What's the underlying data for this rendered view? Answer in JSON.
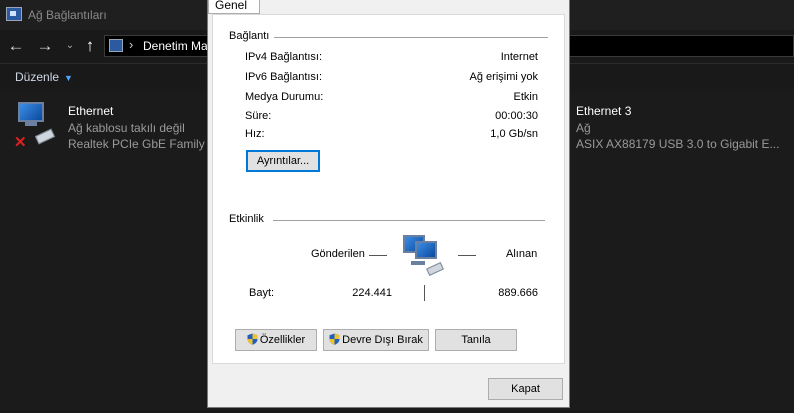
{
  "explorer": {
    "title": "Ağ Bağlantıları",
    "breadcrumb": "Denetim Ma",
    "organize_label": "Düzenle",
    "adapters": [
      {
        "name": "Ethernet",
        "status": "Ağ kablosu takılı değil",
        "device": "Realtek PCIe GbE Family Co",
        "disconnected": true
      },
      {
        "name": "Ethernet 3",
        "status": "Ağ",
        "device": "ASIX AX88179 USB 3.0 to Gigabit E...",
        "disconnected": false
      }
    ]
  },
  "dialog": {
    "tab_label": "Genel",
    "connection": {
      "group_label": "Bağlantı",
      "rows": [
        {
          "label": "IPv4 Bağlantısı:",
          "value": "Internet"
        },
        {
          "label": "IPv6 Bağlantısı:",
          "value": "Ağ erişimi yok"
        },
        {
          "label": "Medya Durumu:",
          "value": "Etkin"
        },
        {
          "label": "Süre:",
          "value": "00:00:30"
        },
        {
          "label": "Hız:",
          "value": "1,0 Gb/sn"
        }
      ],
      "details_button": "Ayrıntılar..."
    },
    "activity": {
      "group_label": "Etkinlik",
      "sent_label": "Gönderilen",
      "received_label": "Alınan",
      "bytes_label": "Bayt:",
      "bytes_sent": "224.441",
      "bytes_received": "889.666"
    },
    "buttons": {
      "properties": "Özellikler",
      "disable": "Devre Dışı Bırak",
      "diagnose": "Tanıla",
      "close": "Kapat"
    }
  },
  "colors": {
    "dark_bg": "#1b1b1b",
    "dialog_bg": "#f0f0f0",
    "focus_blue": "#0078d7",
    "error_red": "#e02020"
  }
}
